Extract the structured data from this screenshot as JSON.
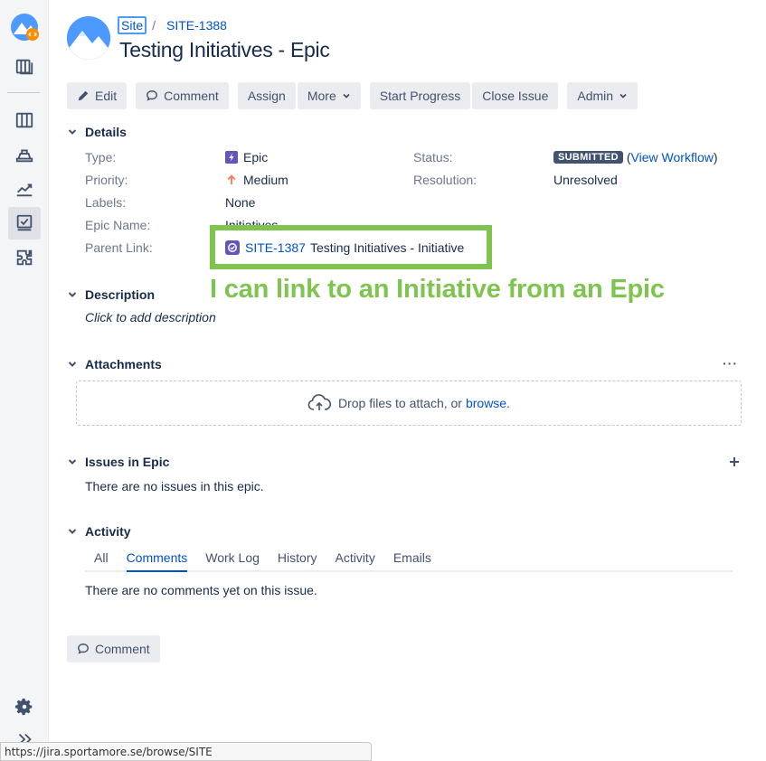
{
  "breadcrumb": {
    "project": "Site",
    "separator": "/",
    "issue_key": "SITE-1388"
  },
  "issue": {
    "title": "Testing Initiatives - Epic"
  },
  "toolbar": {
    "edit": "Edit",
    "comment": "Comment",
    "assign": "Assign",
    "more": "More",
    "start_progress": "Start Progress",
    "close_issue": "Close Issue",
    "admin": "Admin"
  },
  "details": {
    "heading": "Details",
    "type_label": "Type:",
    "type_value": "Epic",
    "priority_label": "Priority:",
    "priority_value": "Medium",
    "labels_label": "Labels:",
    "labels_value": "None",
    "epic_name_label": "Epic Name:",
    "epic_name_value": "Initiatives",
    "parent_link_label": "Parent Link:",
    "parent_key": "SITE-1387",
    "parent_title": "Testing Initiatives - Initiative",
    "status_label": "Status:",
    "status_value": "SUBMITTED",
    "view_workflow": "View Workflow",
    "resolution_label": "Resolution:",
    "resolution_value": "Unresolved"
  },
  "annotation": "I can link to an Initiative from an Epic",
  "description": {
    "heading": "Description",
    "placeholder": "Click to add description"
  },
  "attachments": {
    "heading": "Attachments",
    "drop_text": "Drop files to attach, or",
    "browse": "browse."
  },
  "issues_in_epic": {
    "heading": "Issues in Epic",
    "empty": "There are no issues in this epic."
  },
  "activity": {
    "heading": "Activity",
    "tabs": [
      "All",
      "Comments",
      "Work Log",
      "History",
      "Activity",
      "Emails"
    ],
    "active_tab": "Comments",
    "empty": "There are no comments yet on this issue.",
    "comment_button": "Comment"
  },
  "status_bar": {
    "url": "https://jira.sportamore.se/browse/SITE"
  },
  "colors": {
    "annotation_green": "#7ec44f",
    "link_blue": "#0052cc",
    "epic_purple": "#6554c0",
    "priority_orange": "#ff7452"
  }
}
